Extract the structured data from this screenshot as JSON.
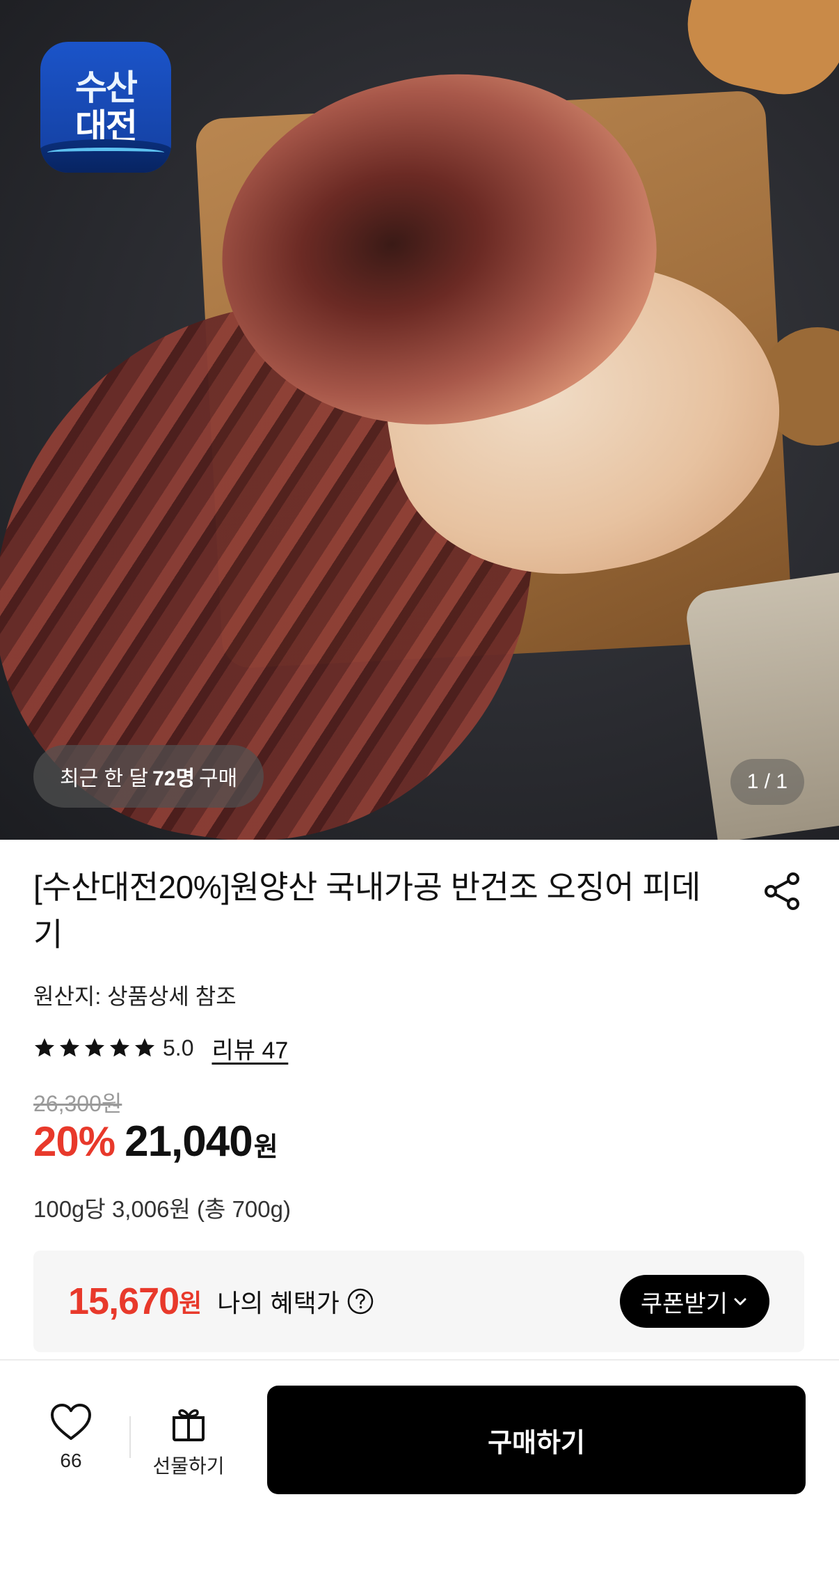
{
  "hero": {
    "logo_line1": "수산",
    "logo_line2": "대전",
    "recent_prefix": "최근 한 달",
    "recent_count": "72명",
    "recent_suffix": "구매",
    "pager": "1 / 1"
  },
  "product": {
    "title": "[수산대전20%]원양산 국내가공 반건조 오징어 피데기",
    "origin": "원산지: 상품상세 참조",
    "rating_score": "5.0",
    "rating_stars": 5,
    "reviews_label": "리뷰 47",
    "original_price": "26,300원",
    "discount": "20%",
    "price": "21,040",
    "price_unit": "원",
    "unit_price": "100g당 3,006원 (총 700g)"
  },
  "benefit": {
    "price": "15,670",
    "price_unit": "원",
    "label": "나의 혜택가",
    "coupon_label": "쿠폰받기"
  },
  "bottom_bar": {
    "like_count": "66",
    "gift_label": "선물하기",
    "buy_label": "구매하기"
  },
  "colors": {
    "accent_red": "#e8392b",
    "button_black": "#000000",
    "logo_blue": "#1b54c9"
  },
  "icons": {
    "share": "share-icon",
    "star": "star-icon",
    "help": "question-circle-icon",
    "chevron": "chevron-down-icon",
    "like": "heart-icon",
    "gift": "gift-icon"
  }
}
